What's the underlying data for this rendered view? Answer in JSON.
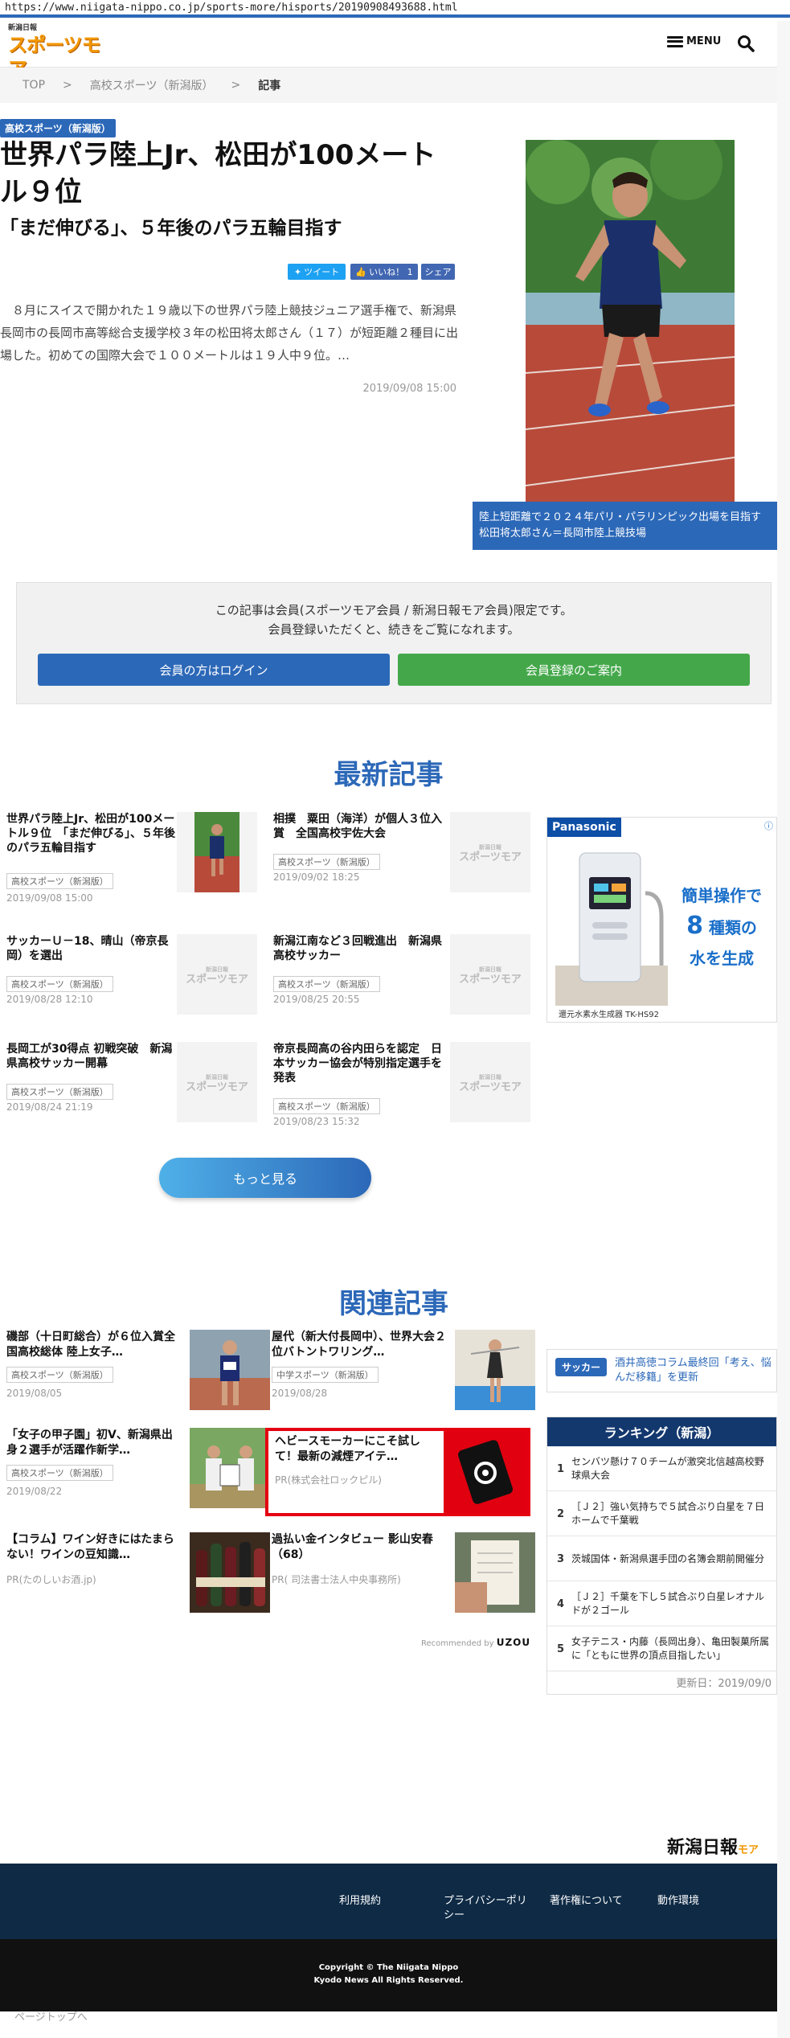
{
  "url": "https://www.niigata-nippo.co.jp/sports-more/hisports/20190908493688.html",
  "header": {
    "logo_small": "新潟日報",
    "logo_big": "スポーツモア",
    "menu_label": "MENU"
  },
  "breadcrumb": {
    "top": "TOP",
    "sep": ">",
    "category": "高校スポーツ（新潟版）",
    "current": "記事"
  },
  "article": {
    "category": "高校スポーツ（新潟版）",
    "title": "世界パラ陸上Jr、松田が100メートル９位",
    "subtitle": "「まだ伸びる」、５年後のパラ五輪目指す",
    "share": {
      "tweet": "ツイート",
      "like": "いいね！ 1",
      "share": "シェア"
    },
    "lead": "８月にスイスで開かれた１９歳以下の世界パラ陸上競技ジュニア選手権で、新潟県長岡市の長岡市高等総合支援学校３年の松田将太郎さん（１７）が短距離２種目に出場した。初めての国際大会で１００メートルは１９人中９位。…",
    "date": "2019/09/08 15:00",
    "photo_caption": "陸上短距離で２０２４年パリ・パラリンピック出場を目指す松田将太郎さん＝長岡市陸上競技場"
  },
  "paywall": {
    "line1": "この記事は会員(スポーツモア会員 / 新潟日報モア会員)限定です。",
    "line2": "会員登録いただくと、続きをご覧になれます。",
    "login_label": "会員の方はログイン",
    "register_label": "会員登録のご案内"
  },
  "latest": {
    "title": "最新記事",
    "more_label": "もっと見る",
    "placeholder_small": "新潟日報",
    "placeholder_big": "スポーツモア",
    "items": [
      {
        "title": "世界パラ陸上Jr、松田が100メートル９位　「まだ伸びる」、５年後のパラ五輪目指す",
        "tag": "高校スポーツ（新潟版）",
        "date": "2019/09/08 15:00"
      },
      {
        "title": "相撲　粟田（海洋）が個人３位入賞　全国高校宇佐大会",
        "tag": "高校スポーツ（新潟版）",
        "date": "2019/09/02 18:25"
      },
      {
        "title": "サッカーＵ－18、晴山（帝京長岡）を選出",
        "tag": "高校スポーツ（新潟版）",
        "date": "2019/08/28 12:10"
      },
      {
        "title": "新潟江南など３回戦進出　新潟県高校サッカー",
        "tag": "高校スポーツ（新潟版）",
        "date": "2019/08/25 20:55"
      },
      {
        "title": "長岡工が30得点 初戦突破　新潟県高校サッカー開幕",
        "tag": "高校スポーツ（新潟版）",
        "date": "2019/08/24 21:19"
      },
      {
        "title": "帝京長岡高の谷内田らを認定　日本サッカー協会が特別指定選手を発表",
        "tag": "高校スポーツ（新潟版）",
        "date": "2019/08/23 15:32"
      }
    ]
  },
  "ad_panasonic": {
    "brand": "Panasonic",
    "copy1": "簡単操作で",
    "copy_num": "8",
    "copy2": "種類の",
    "copy3": "水を生成",
    "product": "還元水素水生成器 TK-HS92"
  },
  "related": {
    "title": "関連記事",
    "items": [
      {
        "title": "磯部（十日町総合）が６位入賞全国高校総体 陸上女子…",
        "tag": "高校スポーツ（新潟版）",
        "date": "2019/08/05"
      },
      {
        "title": "屋代（新大付長岡中）、世界大会２位バトントワリング…",
        "tag": "中学スポーツ（新潟版）",
        "date": "2019/08/28"
      },
      {
        "title": "「女子の甲子園」初V、新潟県出身２選手が活躍作新学…",
        "tag": "高校スポーツ（新潟版）",
        "date": "2019/08/22"
      },
      {
        "title": "【コラム】ワイン好きにはたまらない！ワインの豆知識…",
        "pr": "PR(たのしいお酒.jp)"
      },
      {
        "title": "過払い金インタビュー 影山安春（68）",
        "pr": "PR( 司法書士法人中央事務所)"
      }
    ],
    "ad": {
      "title": "ヘビースモーカーにこそ試して！最新の減煙アイテ…",
      "pr": "PR(株式会社ロックピル)"
    },
    "recommended_by": "Recommended by",
    "uzou": "UZOU"
  },
  "sidebar": {
    "soccer_badge": "サッカー",
    "soccer_link": "酒井高徳コラム最終回「考え、悩んだ移籍」を更新",
    "ranking_title": "ランキング（新潟）",
    "ranking": [
      {
        "n": "1",
        "text": "センバツ懸け７０チームが激突北信越高校野球県大会"
      },
      {
        "n": "2",
        "text": "［Ｊ２］強い気持ちで５試合ぶり白星を７日ホームで千葉戦"
      },
      {
        "n": "3",
        "text": "茨城国体・新潟県選手団の名簿会期前開催分"
      },
      {
        "n": "4",
        "text": "［Ｊ２］千葉を下し５試合ぶり白星レオナルドが２ゴール"
      },
      {
        "n": "5",
        "text": "女子テニス・内藤（長岡出身）、亀田製菓所属に「ともに世界の頂点目指したい」"
      }
    ],
    "updated": "更新日：2019/09/0"
  },
  "footer": {
    "logo": "新潟日報",
    "logo_suffix": "モア",
    "links": [
      "利用規約",
      "プライバシーポリシー",
      "著作権について",
      "動作環境"
    ],
    "copyright1": "Copyright © The Niigata Nippo",
    "copyright2": "Kyodo News All Rights Reserved.",
    "pagetop": "ページトップへ"
  }
}
